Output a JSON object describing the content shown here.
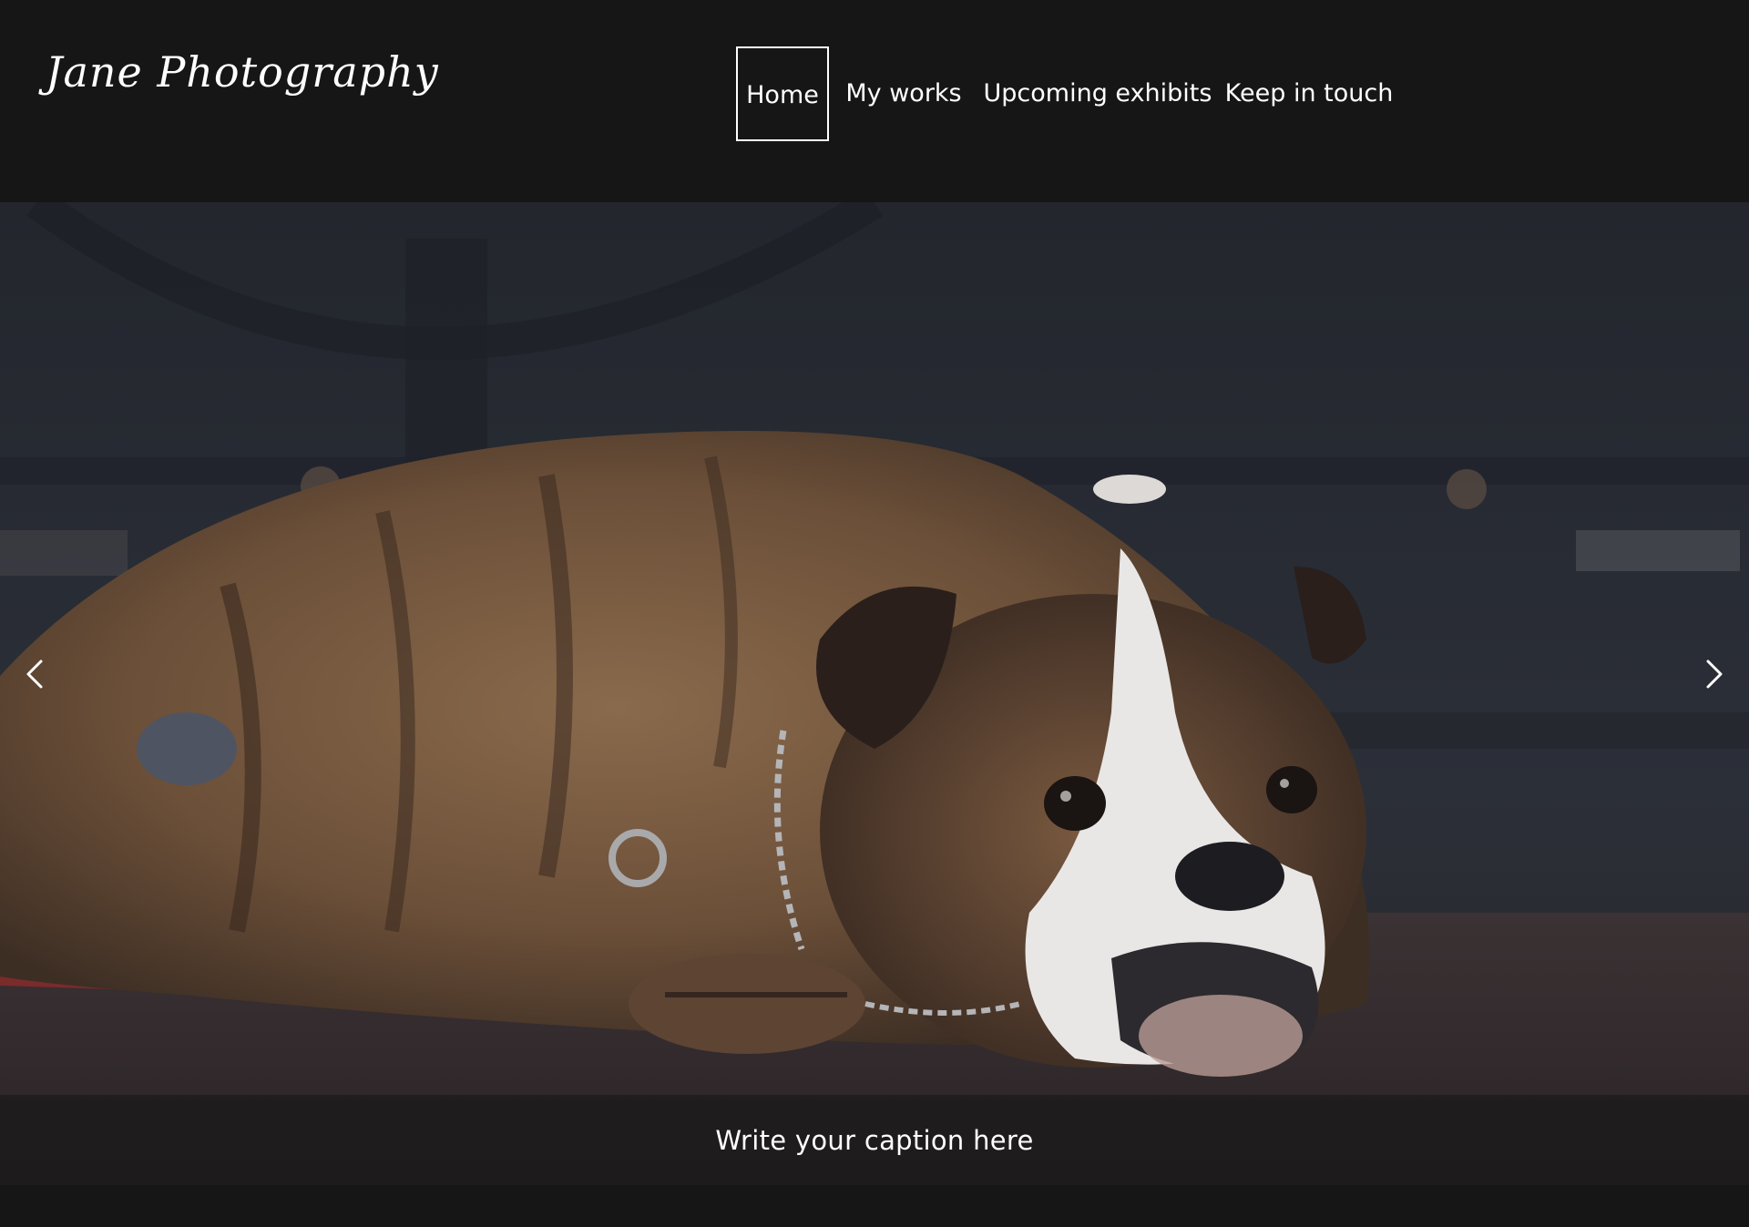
{
  "site": {
    "logo_text": "Jane Photography"
  },
  "nav": {
    "items": [
      {
        "label": "Home",
        "active": true
      },
      {
        "label": "My works",
        "active": false
      },
      {
        "label": "Upcoming exhibits",
        "active": false
      },
      {
        "label": "Keep in touch",
        "active": false
      }
    ]
  },
  "slider": {
    "caption": "Write your caption here",
    "prev_icon": "chevron-left-icon",
    "next_icon": "chevron-right-icon"
  },
  "colors": {
    "background": "#161617",
    "text": "#ffffff"
  }
}
